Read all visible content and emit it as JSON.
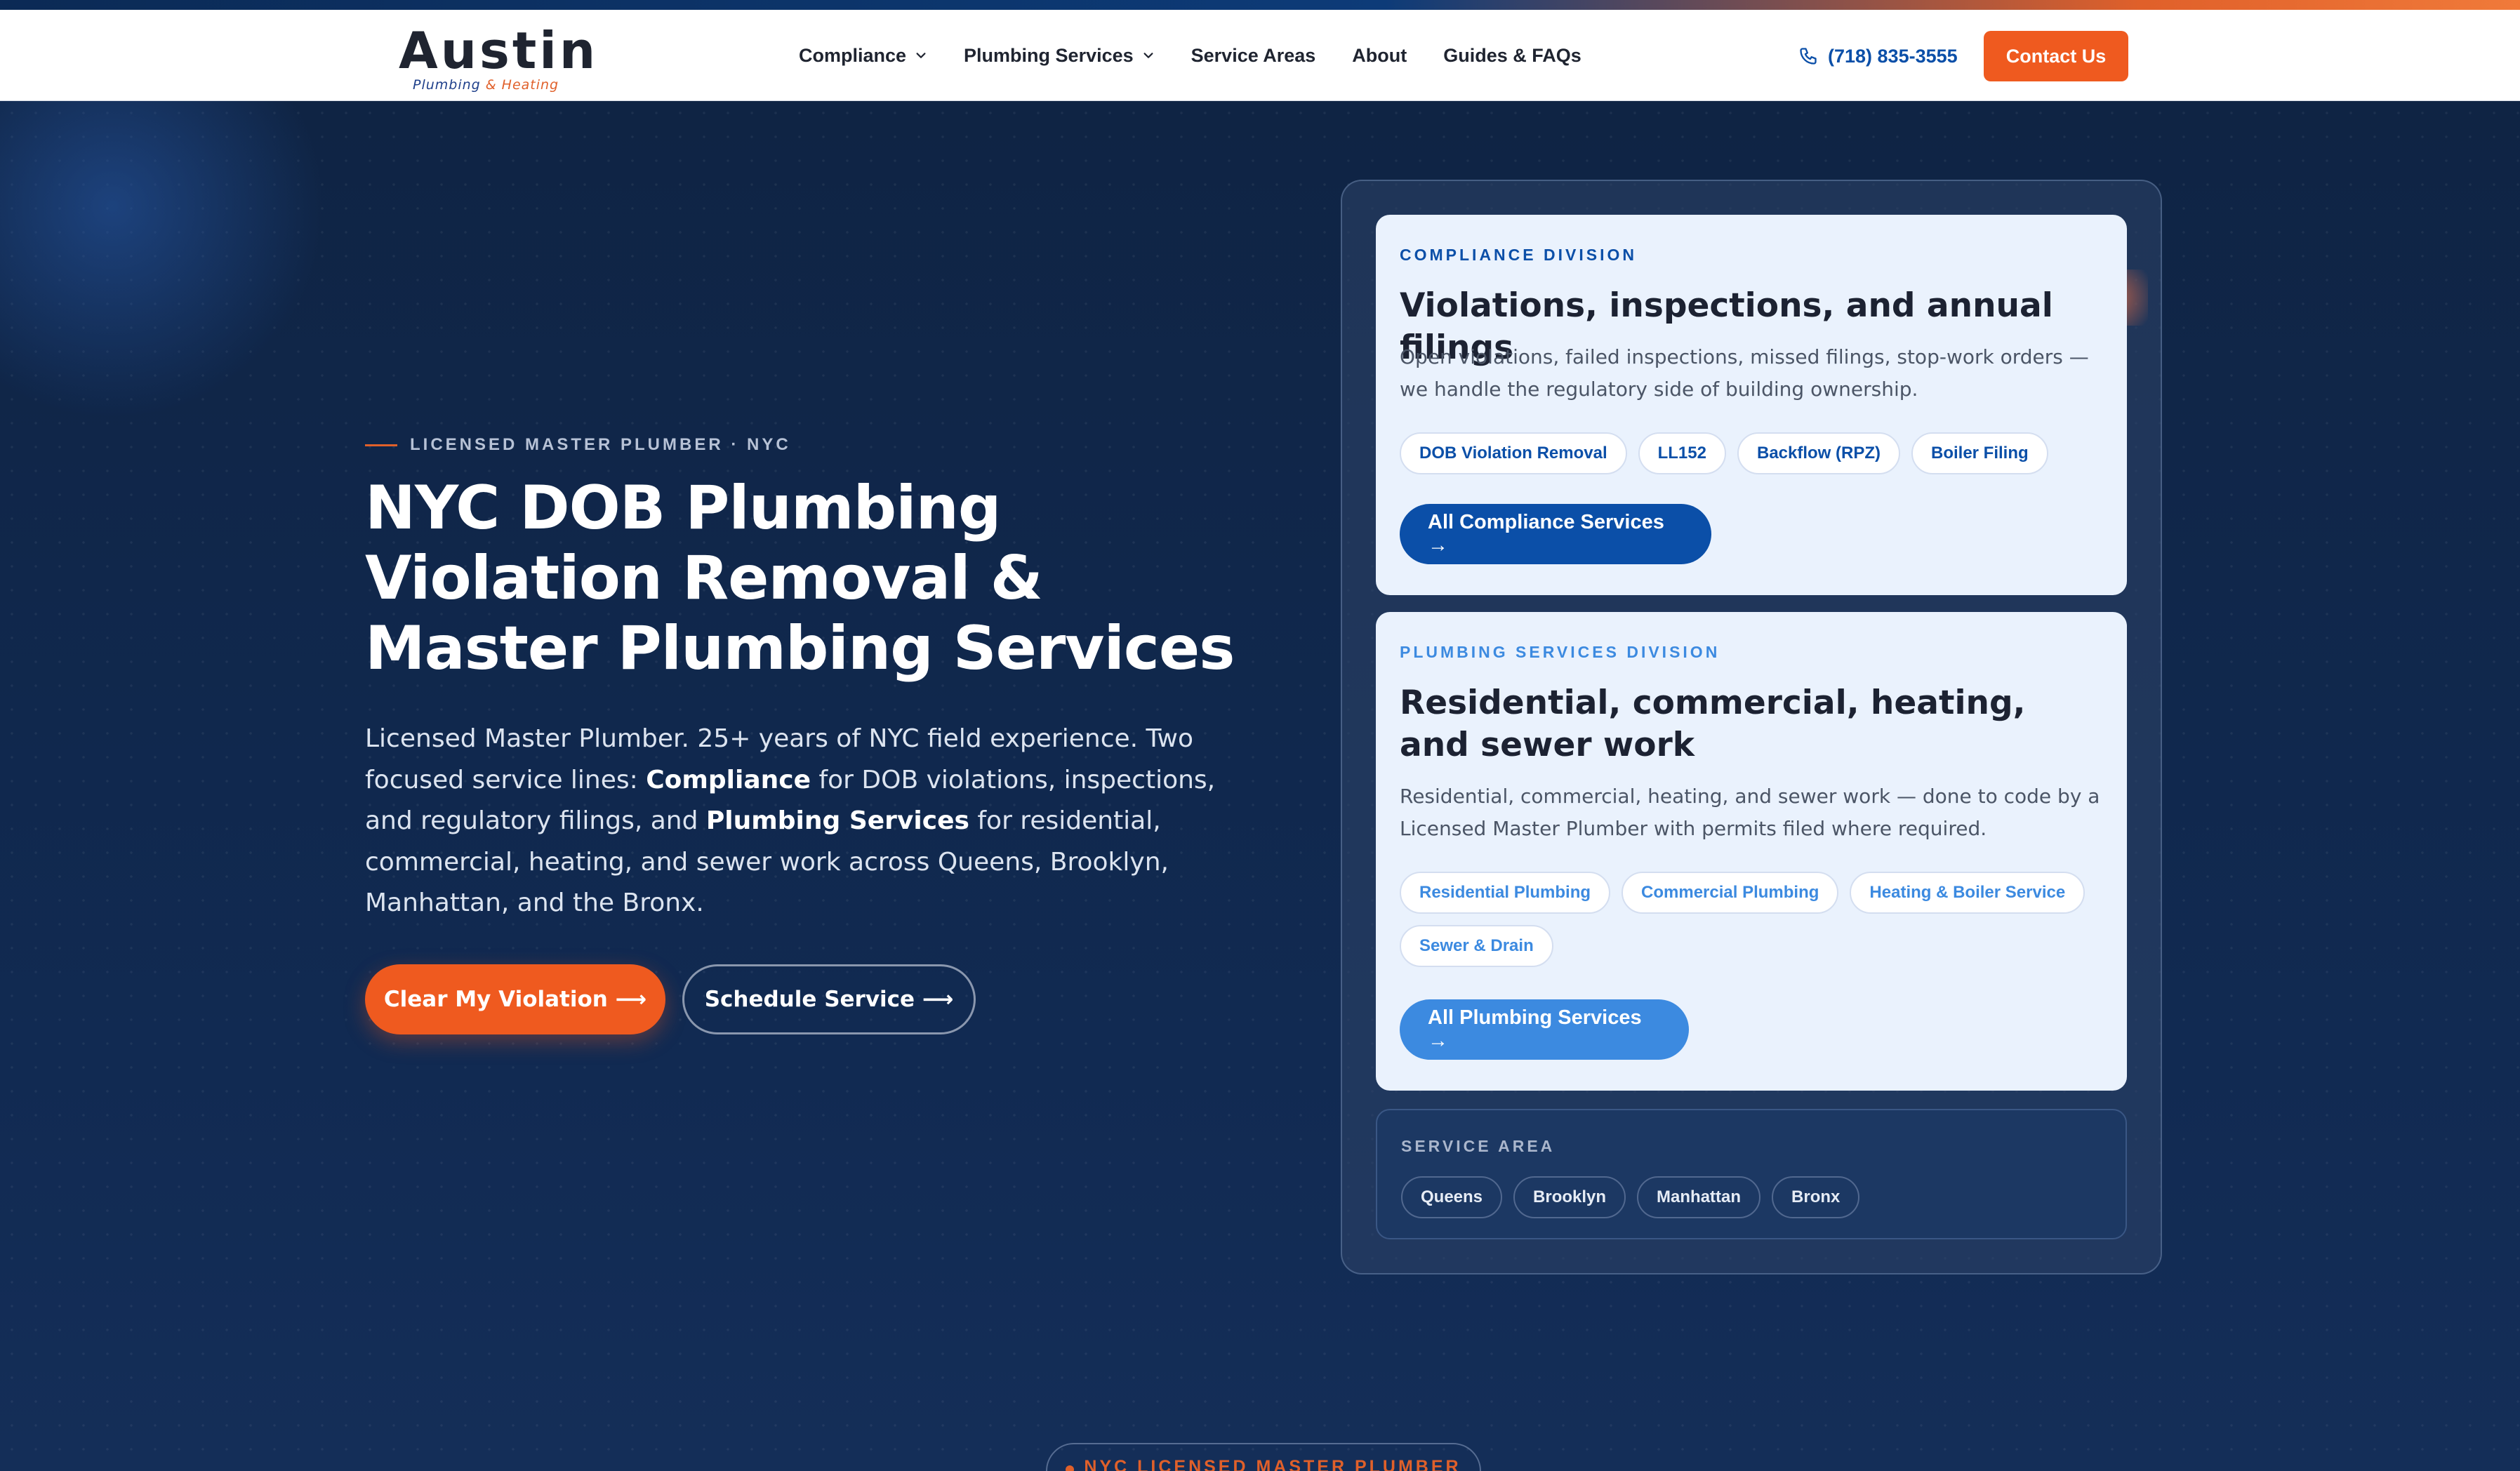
{
  "brand": {
    "name": "Austin",
    "sub_part1": "Plumbing",
    "sub_amp": "&",
    "sub_part2": "Heating",
    "primary_color": "#0b4fa8",
    "accent_color": "#ef5a1f"
  },
  "nav": {
    "items": [
      {
        "label": "Compliance",
        "has_dropdown": true
      },
      {
        "label": "Plumbing Services",
        "has_dropdown": true
      },
      {
        "label": "Service Areas",
        "has_dropdown": false
      },
      {
        "label": "About",
        "has_dropdown": false
      },
      {
        "label": "Guides & FAQs",
        "has_dropdown": false
      }
    ],
    "phone": "(718) 835-3555",
    "contact_label": "Contact Us"
  },
  "hero": {
    "eyebrow": "LICENSED MASTER PLUMBER · NYC",
    "title": "NYC DOB Plumbing Violation Removal & Master Plumbing Services",
    "desc_part1": "Licensed Master Plumber. 25+ years of NYC field experience. Two focused service lines: ",
    "desc_bold1": "Compliance",
    "desc_part2": " for DOB violations, inspections, and regulatory filings, and ",
    "desc_bold2": "Plumbing Services",
    "desc_part3": " for residential, commercial, heating, and sewer work across Queens, Brooklyn, Manhattan, and the Bronx.",
    "primary_cta": "Clear My Violation ⟶",
    "secondary_cta": "Schedule Service ⟶"
  },
  "compliance_card": {
    "eyebrow": "COMPLIANCE DIVISION",
    "title": "Violations, inspections, and annual filings",
    "description": "Open violations, failed inspections, missed filings, stop-work orders — we handle the regulatory side of building ownership.",
    "chips": [
      "DOB Violation Removal",
      "LL152",
      "Backflow (RPZ)",
      "Boiler Filing"
    ],
    "button": "All Compliance Services →"
  },
  "plumbing_card": {
    "eyebrow": "PLUMBING SERVICES DIVISION",
    "title": "Residential, commercial, heating, and sewer work",
    "description": "Residential, commercial, heating, and sewer work — done to code by a Licensed Master Plumber with permits filed where required.",
    "chips": [
      "Residential Plumbing",
      "Commercial Plumbing",
      "Heating & Boiler Service",
      "Sewer & Drain"
    ],
    "button": "All Plumbing Services →"
  },
  "service_area": {
    "eyebrow": "SERVICE AREA",
    "chips": [
      "Queens",
      "Brooklyn",
      "Manhattan",
      "Bronx"
    ]
  },
  "bottom_badge": "NYC LICENSED MASTER PLUMBER"
}
